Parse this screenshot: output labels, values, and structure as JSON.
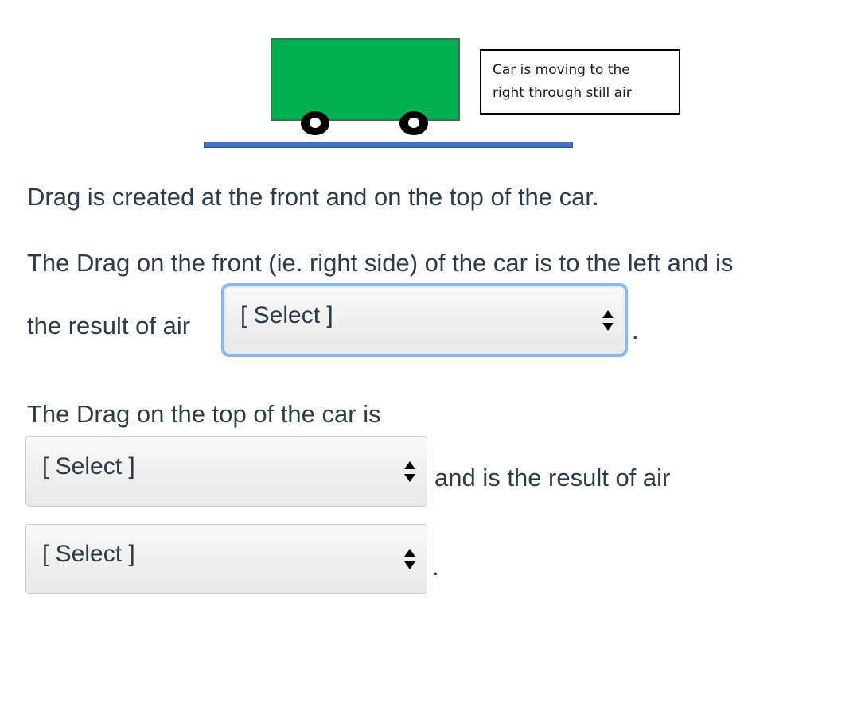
{
  "figure": {
    "note": [
      "Car is moving to the",
      "right through still air"
    ],
    "colors": {
      "car_body": "#00b050",
      "ground": "#4472c4",
      "wheel": "#000000"
    }
  },
  "question": {
    "sentence1": "Drag is created at the front and on the top of the car.",
    "sentence2_line1": "The Drag on the front (ie. right side) of the car is to the left and is",
    "sentence2_line2": "the result of air",
    "select1": {
      "value": "[ Select ]"
    },
    "period1": ".",
    "sentence3": "The Drag on the top of the car is",
    "select2": {
      "value": "[ Select ]"
    },
    "after_select2": "and is the result of air",
    "select3": {
      "value": "[ Select ]"
    },
    "period2": "."
  }
}
